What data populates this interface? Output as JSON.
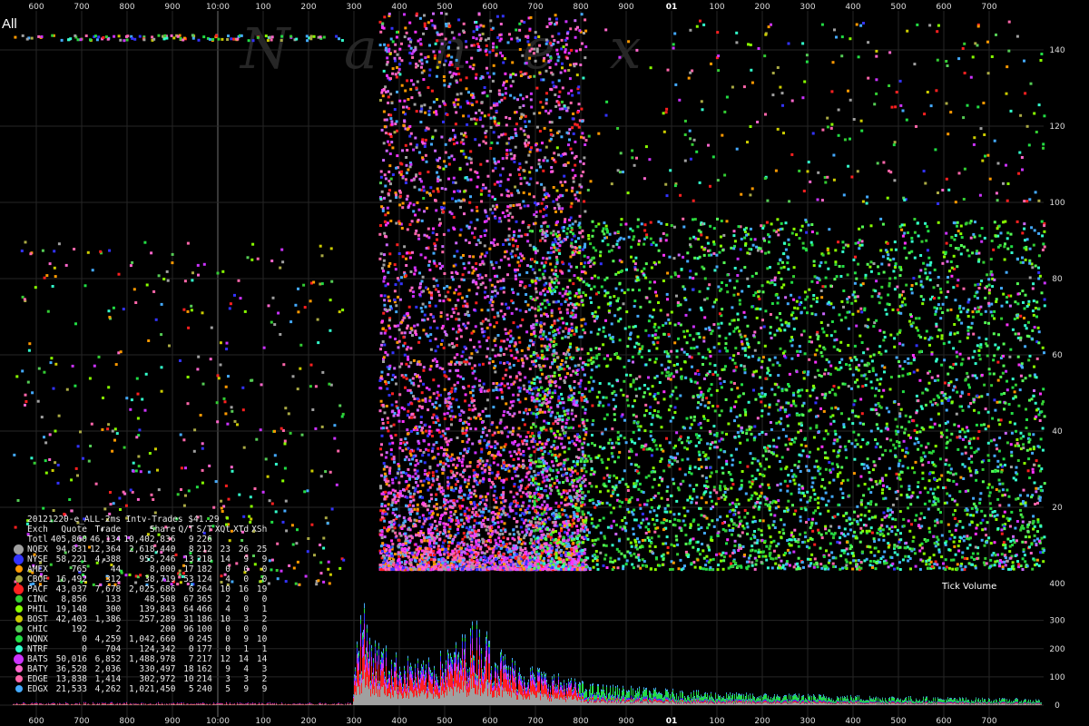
{
  "chart_label": "All",
  "watermark": "N a n e x",
  "title_line": "20121220-e_ALL-2ms Intv-Trades $41.29",
  "volume_label": "Tick Volume",
  "top_axis": {
    "ticks": [
      "600",
      "700",
      "800",
      "900",
      "10:00",
      "100",
      "200",
      "300",
      "400",
      "500",
      "600",
      "700",
      "800",
      "900",
      "01",
      "100",
      "200",
      "300",
      "400",
      "500",
      "600",
      "700"
    ]
  },
  "bottom_axis": {
    "ticks": [
      "600",
      "700",
      "800",
      "900",
      "10:00",
      "100",
      "200",
      "300",
      "400",
      "500",
      "600",
      "700",
      "800",
      "900",
      "01",
      "100",
      "200",
      "300",
      "400",
      "500",
      "600",
      "700"
    ]
  },
  "colors": {
    "background": "#000000",
    "grid": "#4a4a4a",
    "axis_text": "#ffffff",
    "watermark": "#2a2a2a"
  },
  "exchanges_palette": {
    "NQEX": "#a0a0a0",
    "NYSE": "#3333ff",
    "AMEX": "#ff9900",
    "CBOE": "#aaaa44",
    "PACF": "#ff2020",
    "CINC": "#33cc33",
    "PHIL": "#88ff00",
    "BOST": "#cccc00",
    "CHIC": "#55cc55",
    "NQNX": "#22dd44",
    "NTRF": "#33ffcc",
    "BATS": "#cc33ff",
    "BATY": "#ff66cc",
    "EDGE": "#ff66aa",
    "EDGX": "#44aaff"
  },
  "stats": {
    "headers": [
      "Exch",
      "Quote",
      "Trade",
      "Share",
      "Q/T",
      "S/T",
      "XQt",
      "XTd",
      "XSh"
    ],
    "rows": [
      {
        "exch": "Totl",
        "quote": "405,860",
        "trade": "46,134",
        "share": "10,402,836",
        "qt": "9",
        "st": "226",
        "xqt": "",
        "xtd": "",
        "xsh": "",
        "color": ""
      },
      {
        "exch": "NQEX",
        "quote": "94,831",
        "trade": "12,364",
        "share": "2,618,440",
        "qt": "8",
        "st": "212",
        "xqt": "23",
        "xtd": "26",
        "xsh": "25",
        "color": "#a0a0a0",
        "big": true
      },
      {
        "exch": "NYSE",
        "quote": "58,221",
        "trade": "4,388",
        "share": "955,246",
        "qt": "13",
        "st": "218",
        "xqt": "14",
        "xtd": "9",
        "xsh": "9",
        "color": "#3333ff",
        "big": true
      },
      {
        "exch": "AMEX",
        "quote": "765",
        "trade": "44",
        "share": "8,000",
        "qt": "17",
        "st": "182",
        "xqt": "0",
        "xtd": "0",
        "xsh": "0",
        "color": "#ff9900"
      },
      {
        "exch": "CBOE",
        "quote": "16,492",
        "trade": "312",
        "share": "38,719",
        "qt": "53",
        "st": "124",
        "xqt": "4",
        "xtd": "0",
        "xsh": "0",
        "color": "#aaaa44"
      },
      {
        "exch": "PACF",
        "quote": "43,037",
        "trade": "7,678",
        "share": "2,025,686",
        "qt": "6",
        "st": "264",
        "xqt": "10",
        "xtd": "16",
        "xsh": "19",
        "color": "#ff2020",
        "big": true
      },
      {
        "exch": "CINC",
        "quote": "8,856",
        "trade": "133",
        "share": "48,508",
        "qt": "67",
        "st": "365",
        "xqt": "2",
        "xtd": "0",
        "xsh": "0",
        "color": "#33cc33"
      },
      {
        "exch": "PHIL",
        "quote": "19,148",
        "trade": "300",
        "share": "139,843",
        "qt": "64",
        "st": "466",
        "xqt": "4",
        "xtd": "0",
        "xsh": "1",
        "color": "#88ff00"
      },
      {
        "exch": "BOST",
        "quote": "42,403",
        "trade": "1,386",
        "share": "257,289",
        "qt": "31",
        "st": "186",
        "xqt": "10",
        "xtd": "3",
        "xsh": "2",
        "color": "#cccc00"
      },
      {
        "exch": "CHIC",
        "quote": "192",
        "trade": "2",
        "share": "200",
        "qt": "96",
        "st": "100",
        "xqt": "0",
        "xtd": "0",
        "xsh": "0",
        "color": "#55cc55"
      },
      {
        "exch": "NQNX",
        "quote": "0",
        "trade": "4,259",
        "share": "1,042,660",
        "qt": "0",
        "st": "245",
        "xqt": "0",
        "xtd": "9",
        "xsh": "10",
        "color": "#22dd44"
      },
      {
        "exch": "NTRF",
        "quote": "0",
        "trade": "704",
        "share": "124,342",
        "qt": "0",
        "st": "177",
        "xqt": "0",
        "xtd": "1",
        "xsh": "1",
        "color": "#33ffcc"
      },
      {
        "exch": "BATS",
        "quote": "50,016",
        "trade": "6,852",
        "share": "1,488,978",
        "qt": "7",
        "st": "217",
        "xqt": "12",
        "xtd": "14",
        "xsh": "14",
        "color": "#cc33ff",
        "big": true
      },
      {
        "exch": "BATY",
        "quote": "36,528",
        "trade": "2,036",
        "share": "330,497",
        "qt": "18",
        "st": "162",
        "xqt": "9",
        "xtd": "4",
        "xsh": "3",
        "color": "#ff66cc"
      },
      {
        "exch": "EDGE",
        "quote": "13,838",
        "trade": "1,414",
        "share": "302,972",
        "qt": "10",
        "st": "214",
        "xqt": "3",
        "xtd": "3",
        "xsh": "2",
        "color": "#ff66aa"
      },
      {
        "exch": "EDGX",
        "quote": "21,533",
        "trade": "4,262",
        "share": "1,021,450",
        "qt": "5",
        "st": "240",
        "xqt": "5",
        "xtd": "9",
        "xsh": "9",
        "color": "#44aaff"
      }
    ]
  },
  "chart_data": [
    {
      "type": "scatter",
      "title": "",
      "xlabel": "",
      "ylabel": "",
      "y_ticks": [
        20,
        40,
        60,
        80,
        100,
        120,
        140
      ],
      "ylim": [
        0,
        150
      ],
      "xlim": [
        0,
        1
      ],
      "grid": true,
      "regions": [
        {
          "x0": 0.0,
          "x1": 0.333,
          "density": "sparse",
          "ymax": 150,
          "dominant": "mixed"
        },
        {
          "x0": 0.333,
          "x1": 0.55,
          "density": "very dense",
          "ymax": 150,
          "dominant": "red/magenta/blue"
        },
        {
          "x0": 0.55,
          "x1": 1.0,
          "density": "dense",
          "ymax": 100,
          "dominant": "green"
        }
      ]
    },
    {
      "type": "bar",
      "title": "",
      "ylabel": "",
      "y_ticks": [
        0,
        100,
        200,
        300
      ],
      "ylim": [
        0,
        360
      ],
      "label": "Tick Volume",
      "profile": [
        {
          "x": 0.33,
          "v": 30
        },
        {
          "x": 0.335,
          "v": 280
        },
        {
          "x": 0.34,
          "v": 330
        },
        {
          "x": 0.35,
          "v": 220
        },
        {
          "x": 0.37,
          "v": 170
        },
        {
          "x": 0.4,
          "v": 140
        },
        {
          "x": 0.43,
          "v": 200
        },
        {
          "x": 0.45,
          "v": 280
        },
        {
          "x": 0.48,
          "v": 160
        },
        {
          "x": 0.52,
          "v": 110
        },
        {
          "x": 0.56,
          "v": 70
        },
        {
          "x": 0.62,
          "v": 55
        },
        {
          "x": 0.7,
          "v": 40
        },
        {
          "x": 0.78,
          "v": 35
        },
        {
          "x": 0.85,
          "v": 30
        },
        {
          "x": 0.92,
          "v": 25
        },
        {
          "x": 1.0,
          "v": 20
        }
      ]
    }
  ]
}
